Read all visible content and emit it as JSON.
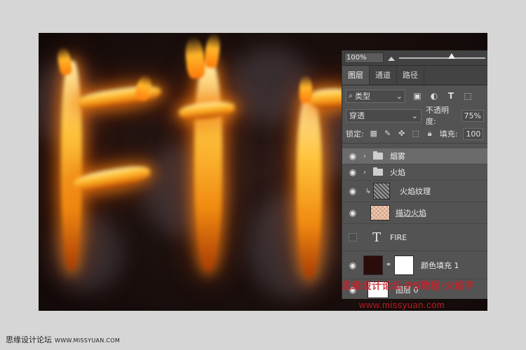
{
  "panel": {
    "zoom": "100%",
    "tabs": [
      "图层",
      "通道",
      "路径"
    ],
    "filter": {
      "kind_label": "类型",
      "kind_icon": "search-icon"
    },
    "blend": {
      "mode": "穿透",
      "opacity_label": "不透明度:",
      "opacity_value": "75%"
    },
    "lock": {
      "label": "锁定:",
      "fill_label": "填充:",
      "fill_value": "100"
    },
    "layers": [
      {
        "name": "烟雾",
        "type": "group",
        "visible": true,
        "selected": true
      },
      {
        "name": "火焰",
        "type": "group",
        "visible": true,
        "selected": false
      },
      {
        "name": "火焰纹理",
        "type": "clipped-image",
        "visible": true,
        "selected": false
      },
      {
        "name": "描边火焰",
        "type": "image",
        "visible": true,
        "selected": false
      },
      {
        "name": "FIRE",
        "type": "text",
        "visible": false,
        "selected": false
      },
      {
        "name": "颜色填充 1",
        "type": "fill",
        "visible": true,
        "selected": false
      },
      {
        "name": "图层 0",
        "type": "image",
        "visible": true,
        "selected": false
      }
    ]
  },
  "watermark": {
    "text": "思缘设计论坛·PS教程·火焰字",
    "url": "www.missyuan.com"
  },
  "footer": {
    "site": "思缘设计论坛",
    "url": "WWW.MISSYUAN.COM"
  },
  "colors": {
    "panel_bg": "#535353",
    "selected_layer": "#6b6b6b",
    "fill_color": "#2a0d0b",
    "watermark": "#cd1e28"
  }
}
